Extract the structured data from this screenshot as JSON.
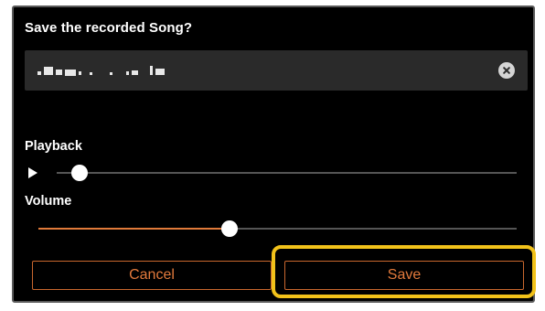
{
  "dialog": {
    "title": "Save the recorded Song?",
    "name_field": {
      "value": "■■■■■ ■ ■ ■ ■■",
      "clear_icon": "clear-circle-icon"
    },
    "playback": {
      "label": "Playback",
      "play_icon": "play-icon",
      "position_fraction": 0.05
    },
    "volume": {
      "label": "Volume",
      "level_fraction": 0.4
    },
    "buttons": {
      "cancel_label": "Cancel",
      "save_label": "Save"
    }
  },
  "colors": {
    "accent": "#e37a3c",
    "highlight": "#f2c21a",
    "field_background": "#2a2a2a",
    "dialog_background": "#000000"
  }
}
